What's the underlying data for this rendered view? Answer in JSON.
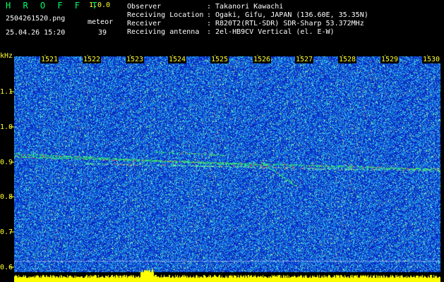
{
  "header": {
    "app_title": "HROFFT",
    "app_version": "1.0.0",
    "file_name": "2504261520.png",
    "mode_label": "meteor",
    "date_time": "25.04.26 15:20",
    "count_value": "39",
    "info": [
      {
        "label": "Observer",
        "value": "Takanori Kawachi"
      },
      {
        "label": "Receiving Location",
        "value": "Ogaki, Gifu, JAPAN (136.60E, 35.35N)"
      },
      {
        "label": "Receiver",
        "value": "R820T2(RTL-SDR) SDR-Sharp 53.372MHz"
      },
      {
        "label": "Receiving antenna",
        "value": "2el-HB9CV Vertical (el. E-W)"
      }
    ],
    "separator": ":"
  },
  "axis": {
    "unit": "kHz",
    "time_labels": [
      "1521",
      "1522",
      "1523",
      "1524",
      "1525",
      "1526",
      "1527",
      "1528",
      "1529",
      "1530"
    ],
    "freq_labels": [
      "1.1",
      "1.0",
      "0.9",
      "0.8",
      "0.7",
      "0.6"
    ]
  },
  "colors": {
    "background": "#000000",
    "label_yellow": "#ffff33",
    "title_green": "#00ff66",
    "noise_base": "#1a2fd0",
    "signal_green": "#33ff66",
    "baseline_yellow": "#ffff00"
  }
}
